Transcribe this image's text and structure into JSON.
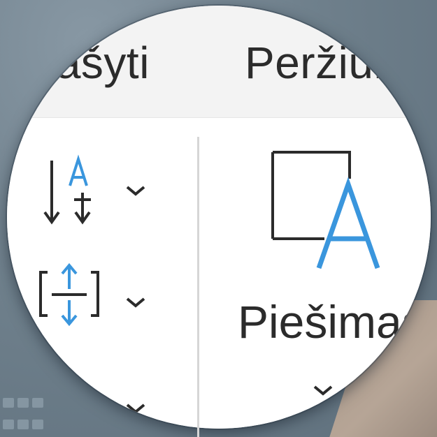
{
  "tabs": [
    {
      "label": "rašyti"
    },
    {
      "label": "Peržiūr"
    }
  ],
  "ribbon": {
    "big_button_label": "Piešimas"
  },
  "icons": {
    "text_direction": "text-direction-icon",
    "align_text": "align-text-icon",
    "drawing_canvas": "drawing-canvas-icon",
    "chevron": "chevron-down-icon",
    "apps_grid": "apps-grid-icon"
  },
  "colors": {
    "accent": "#3a96dd",
    "ink": "#2b2b2b",
    "tabbar": "#f3f3f3"
  }
}
